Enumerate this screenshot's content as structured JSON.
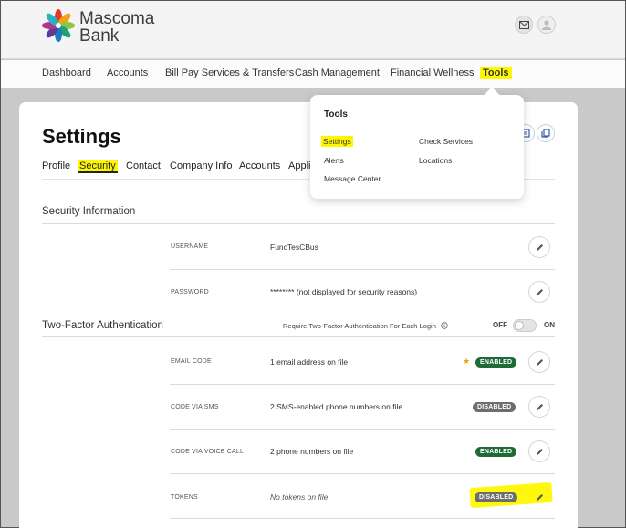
{
  "brand": {
    "line1": "Mascoma",
    "line2": "Bank"
  },
  "header": {
    "mail_icon": "mail-icon",
    "user_icon": "user-icon"
  },
  "nav": {
    "items": [
      "Dashboard",
      "Accounts",
      "Bill Pay Services & Transfers",
      "Cash Management",
      "Financial Wellness",
      "Tools"
    ]
  },
  "dropdown": {
    "title": "Tools",
    "col1": [
      "Settings",
      "Alerts",
      "Message Center"
    ],
    "col2": [
      "Check Services",
      "Locations"
    ]
  },
  "page": {
    "title": "Settings",
    "tabs": [
      "Profile",
      "Security",
      "Contact",
      "Company Info",
      "Accounts",
      "Appli"
    ]
  },
  "security": {
    "title": "Security Information",
    "rows": [
      {
        "label": "USERNAME",
        "value": "FuncTesCBus"
      },
      {
        "label": "PASSWORD",
        "value": "******** (not displayed for security reasons)"
      }
    ]
  },
  "twofa": {
    "title": "Two-Factor Authentication",
    "require_label": "Require Two-Factor Authentication For Each Login",
    "toggle_off": "OFF",
    "toggle_on": "ON",
    "toggle_state": "off",
    "rows": [
      {
        "label": "EMAIL CODE",
        "value": "1 email address on file",
        "status": "ENABLED",
        "starred": true
      },
      {
        "label": "CODE VIA SMS",
        "value": "2 SMS-enabled phone numbers on file",
        "status": "DISABLED"
      },
      {
        "label": "CODE VIA VOICE CALL",
        "value": "2 phone numbers on file",
        "status": "ENABLED"
      },
      {
        "label": "TOKENS",
        "value": "No tokens on file",
        "status": "DISABLED"
      }
    ]
  },
  "colors": {
    "highlight": "#fff700",
    "enabled": "#1f6b36",
    "disabled": "#6d6d6d",
    "star": "#e6a21a"
  }
}
